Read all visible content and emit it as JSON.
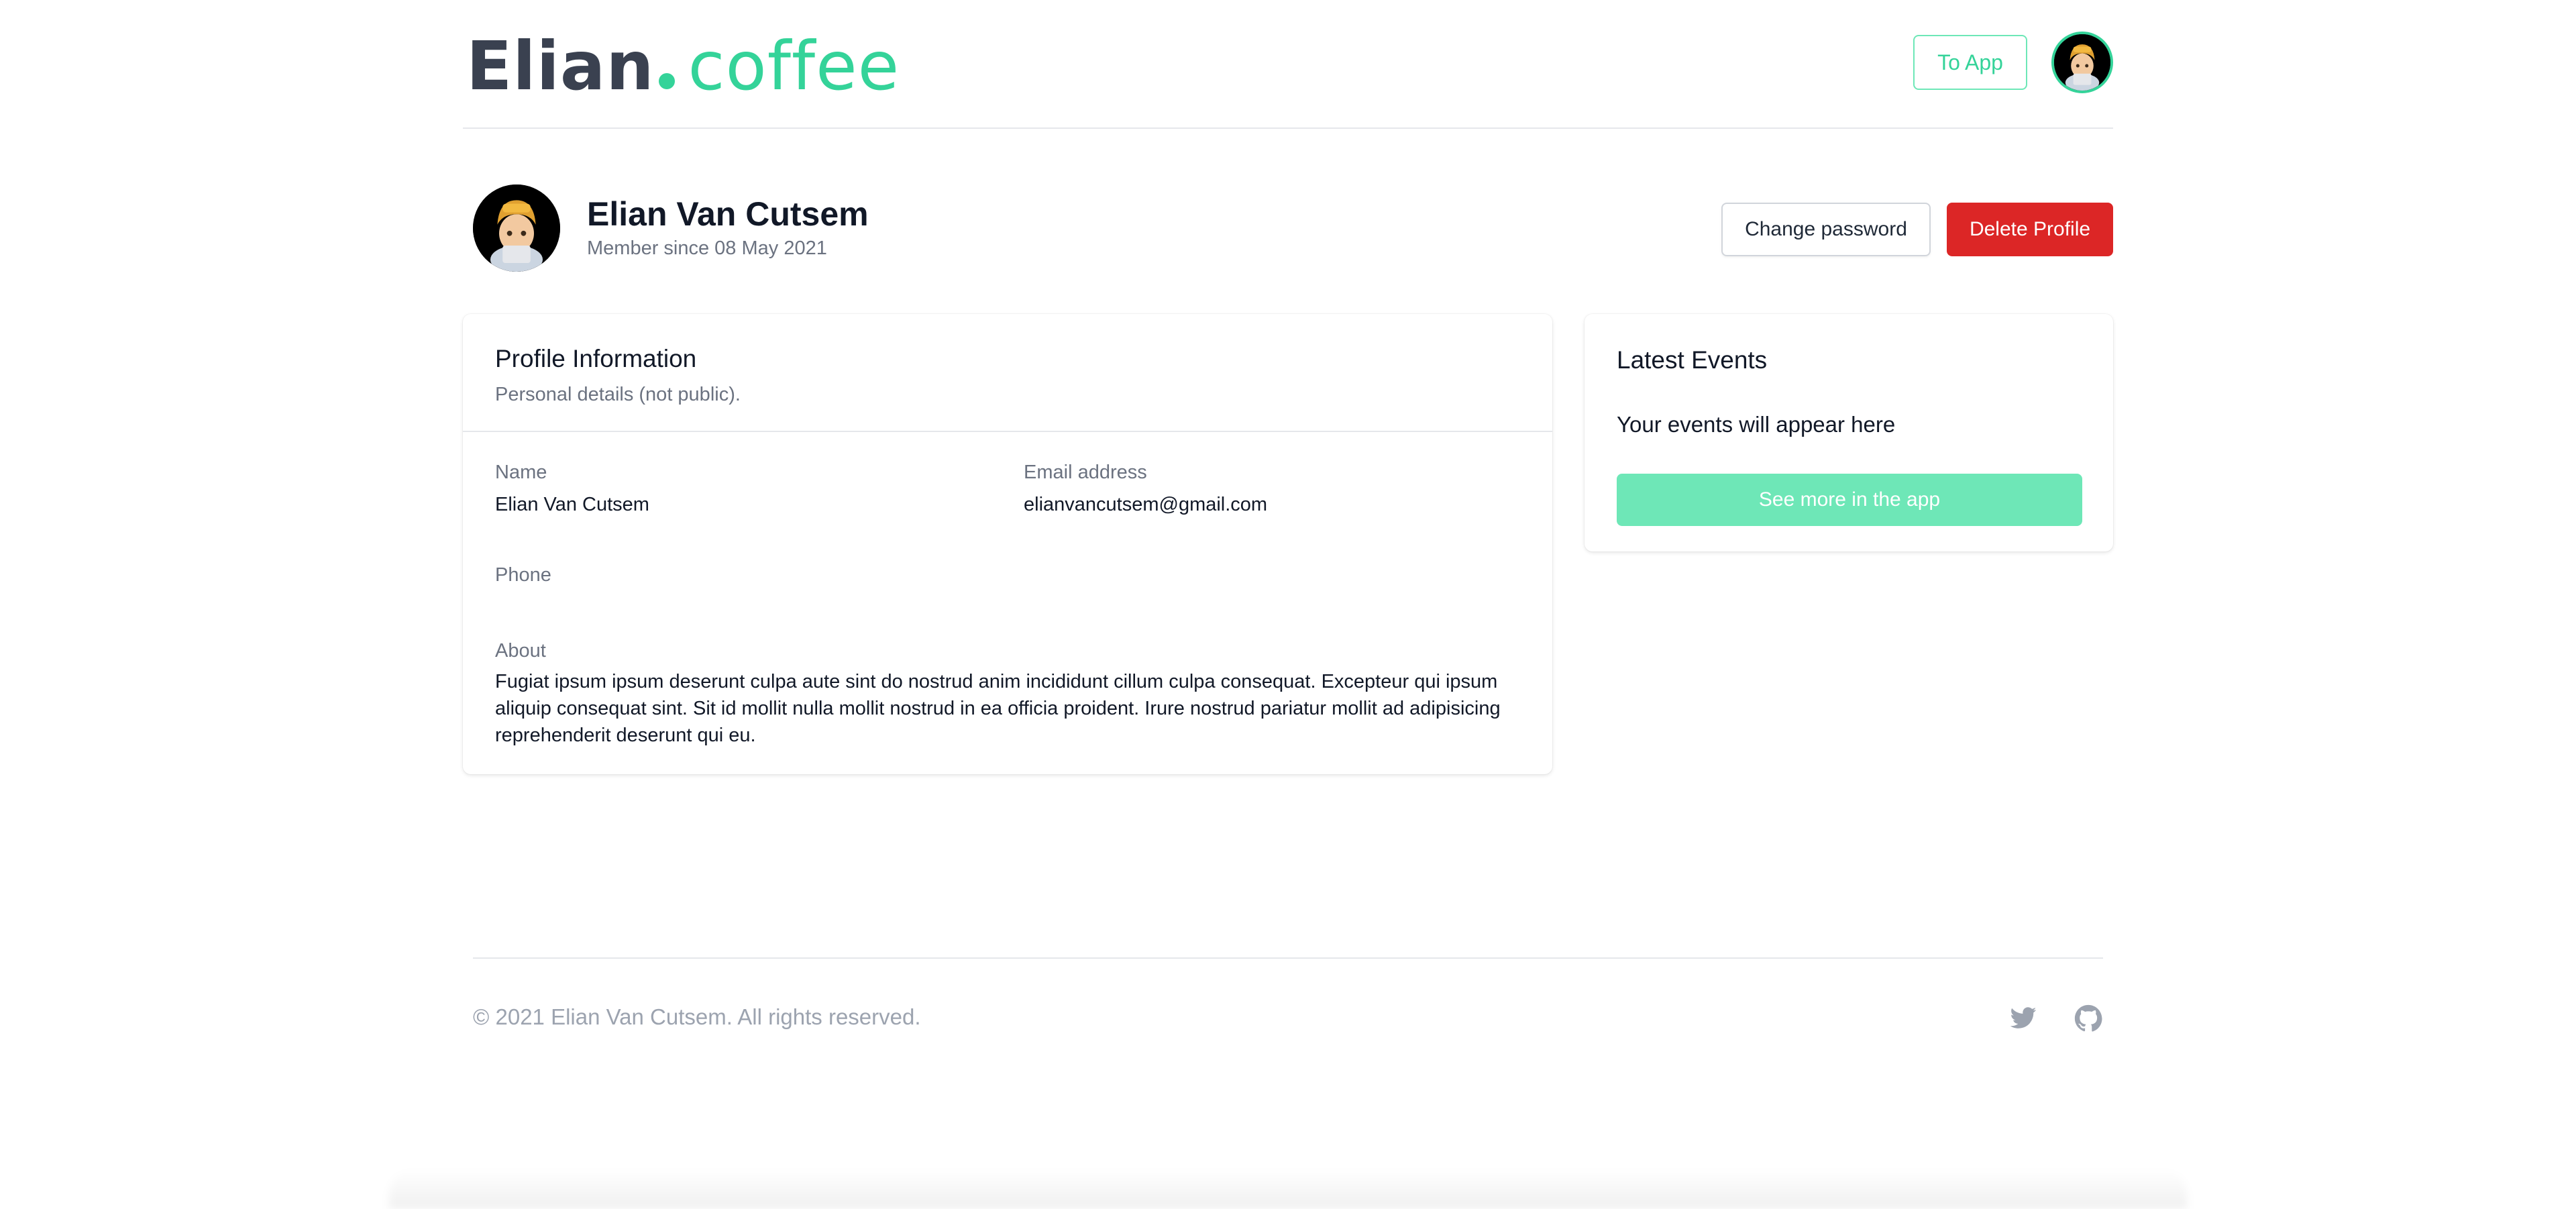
{
  "header": {
    "logo_main": "Elian",
    "logo_accent": "coffee",
    "to_app_label": "To App"
  },
  "profile": {
    "name": "Elian Van Cutsem",
    "member_since": "Member since 08 May 2021",
    "change_password_label": "Change password",
    "delete_label": "Delete Profile"
  },
  "info_card": {
    "title": "Profile Information",
    "subtitle": "Personal details (not public).",
    "name_label": "Name",
    "name_value": "Elian Van Cutsem",
    "email_label": "Email address",
    "email_value": "elianvancutsem@gmail.com",
    "phone_label": "Phone",
    "phone_value": "",
    "about_label": "About",
    "about_value": "Fugiat ipsum ipsum deserunt culpa aute sint do nostrud anim incididunt cillum culpa consequat. Excepteur qui ipsum aliquip consequat sint. Sit id mollit nulla mollit nostrud in ea officia proident. Irure nostrud pariatur mollit ad adipisicing reprehenderit deserunt qui eu."
  },
  "events_card": {
    "title": "Latest Events",
    "empty_text": "Your events will appear here",
    "button_label": "See more in the app"
  },
  "footer": {
    "copyright": "© 2021 Elian Van Cutsem. All rights reserved.",
    "icons": [
      "twitter-icon",
      "github-icon"
    ]
  },
  "colors": {
    "accent": "#34d399",
    "accent_light": "#6ee7b7",
    "danger": "#dc2626",
    "muted_text": "#6b7280"
  }
}
